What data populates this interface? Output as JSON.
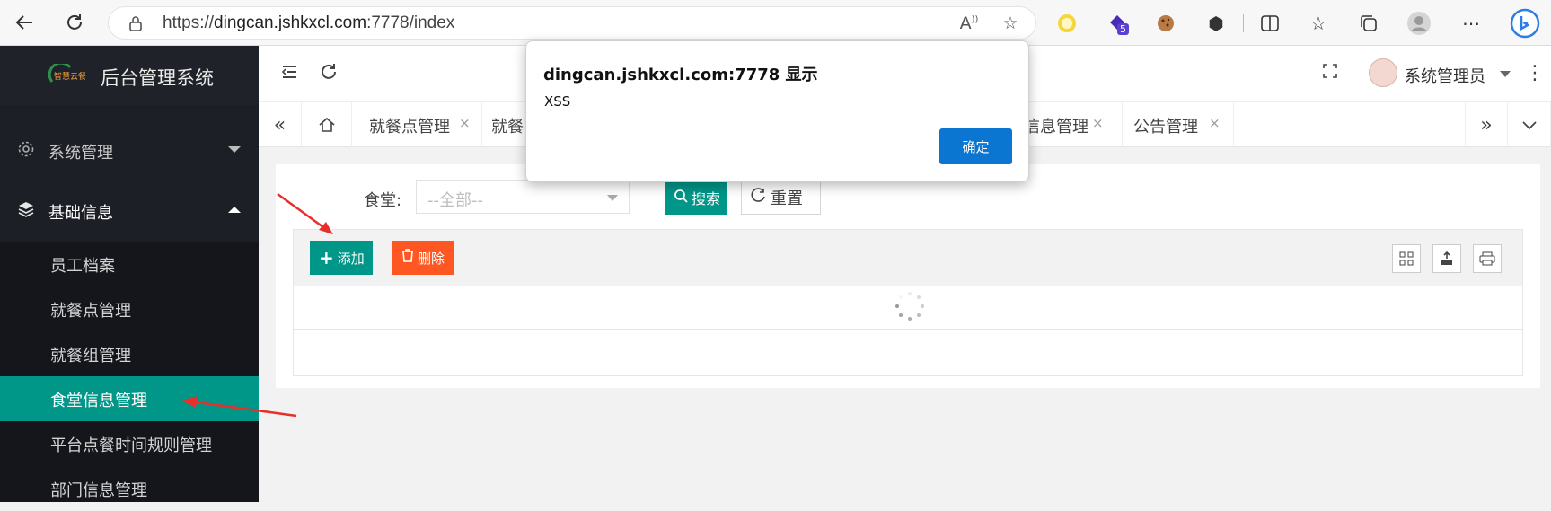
{
  "browser": {
    "url_prefix": "https://",
    "url_host": "dingcan.jshkxcl.com",
    "url_rest": ":7778/index",
    "icons": [
      "back-icon",
      "refresh-icon",
      "lock-icon",
      "read-aloud-icon",
      "favorite-add-icon",
      "extension-ring-icon",
      "extension-badge-icon",
      "cookie-icon",
      "puzzle-icon",
      "split-screen-icon",
      "favorites-icon",
      "collections-icon",
      "profile-icon",
      "more-icon",
      "bing-icon"
    ],
    "badge_count": "5"
  },
  "sidebar": {
    "logo_text": "智慧云餐",
    "title": "后台管理系统",
    "groups": [
      {
        "label": "系统管理",
        "icon": "gear-icon",
        "expanded": false
      },
      {
        "label": "基础信息",
        "icon": "layers-icon",
        "expanded": true
      }
    ],
    "items": [
      {
        "label": "员工档案"
      },
      {
        "label": "就餐点管理"
      },
      {
        "label": "就餐组管理"
      },
      {
        "label": "食堂信息管理",
        "active": true
      },
      {
        "label": "平台点餐时间规则管理"
      },
      {
        "label": "部门信息管理"
      }
    ]
  },
  "header": {
    "user_name": "系统管理员"
  },
  "tabs": {
    "items": [
      {
        "label": "就餐点管理"
      },
      {
        "label": "就餐"
      },
      {
        "label": "信息管理"
      },
      {
        "label": "公告管理"
      }
    ],
    "close_glyph": "×"
  },
  "main": {
    "filter_label": "食堂:",
    "select_value": "--全部--",
    "search_label": "搜索",
    "reset_label": "重置",
    "add_label": "添加",
    "delete_label": "删除"
  },
  "dialog": {
    "title": "dingcan.jshkxcl.com:7778 显示",
    "message": "XSS",
    "ok_label": "确定"
  },
  "colors": {
    "primary": "#009688",
    "danger": "#ff5722",
    "sidebar_bg": "#1d1f27",
    "dialog_button": "#0b76d1",
    "annotation_arrow": "#e8302a"
  }
}
